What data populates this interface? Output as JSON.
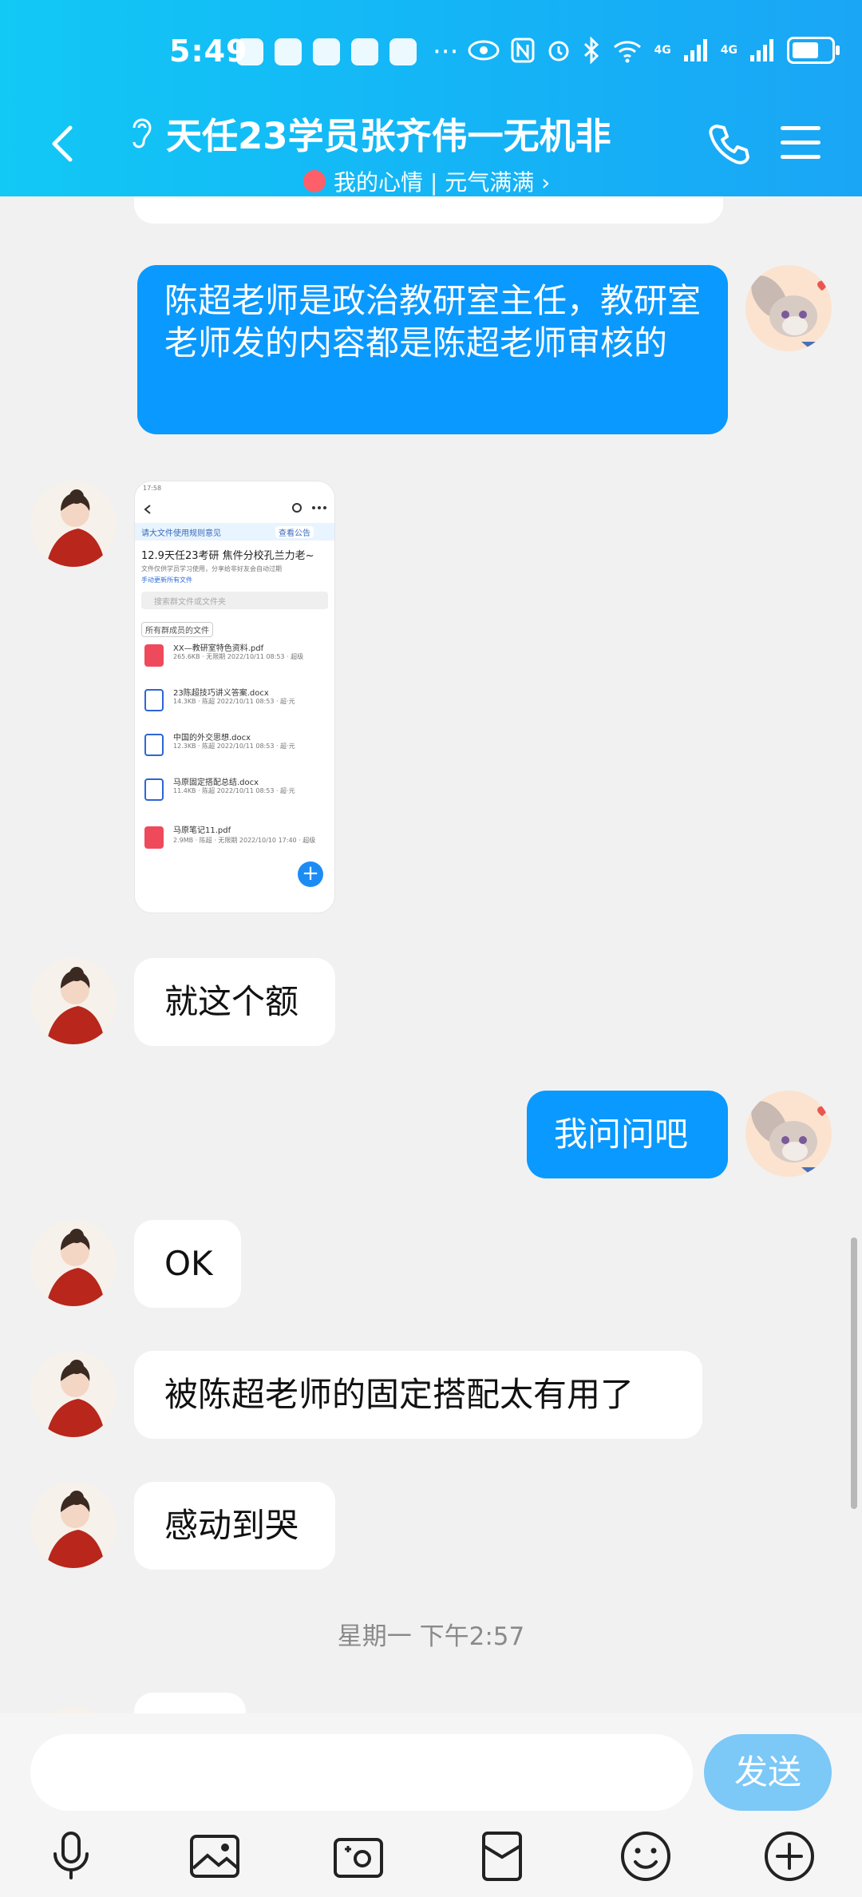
{
  "status_bar": {
    "time": "5:49",
    "more": "···",
    "net1": "4G",
    "net2": "4G"
  },
  "header": {
    "title": "天任23学员张齐伟一无机非",
    "subtitle": "我的心情 | 元气满满 ›"
  },
  "messages": [
    {
      "side": "out",
      "text": "陈超老师是政治教研室主任，教研室老师发的内容都是陈超老师审核的"
    },
    {
      "side": "in",
      "type": "image"
    },
    {
      "side": "in",
      "text": "就这个额"
    },
    {
      "side": "out",
      "text": "我问问吧"
    },
    {
      "side": "in",
      "text": "OK"
    },
    {
      "side": "in",
      "text": "被陈超老师的固定搭配太有用了"
    },
    {
      "side": "in",
      "text": "感动到哭"
    }
  ],
  "timestamp": "星期一 下午2:57",
  "shared_image": {
    "time": "17:58",
    "notice": "请大文件使用规则意见",
    "notice_btn": "查看公告",
    "folder_title": "12.9天任23考研 焦件分校孔兰力老~",
    "sub": "文件仅供学员学习使用，分享给非好友会自动过期",
    "link": "手动更新所有文件",
    "search": "搜索群文件或文件夹",
    "filter": "所有群成员的文件",
    "files": [
      {
        "name": "XX—教研室特色资料.pdf",
        "meta": "265.6KB · 无限期 2022/10/11 08:53 · 超级",
        "type": "pdf"
      },
      {
        "name": "23陈超技巧讲义答案.docx",
        "meta": "14.3KB · 陈超 2022/10/11 08:53 · 超·元",
        "type": "doc"
      },
      {
        "name": "中国的外交思想.docx",
        "meta": "12.3KB · 陈超 2022/10/11 08:53 · 超·元",
        "type": "doc"
      },
      {
        "name": "马原固定搭配总结.docx",
        "meta": "11.4KB · 陈超 2022/10/11 08:53 · 超·元",
        "type": "doc"
      },
      {
        "name": "马原笔记11.pdf",
        "meta": "2.9MB · 陈超 · 无限期 2022/10/10 17:40 · 超级",
        "type": "pdf"
      }
    ]
  },
  "input": {
    "placeholder": "",
    "send_label": "发送"
  },
  "colors": {
    "header": "#14b4f6",
    "out_bubble": "#0a99ff",
    "send": "#7cc8f7"
  }
}
